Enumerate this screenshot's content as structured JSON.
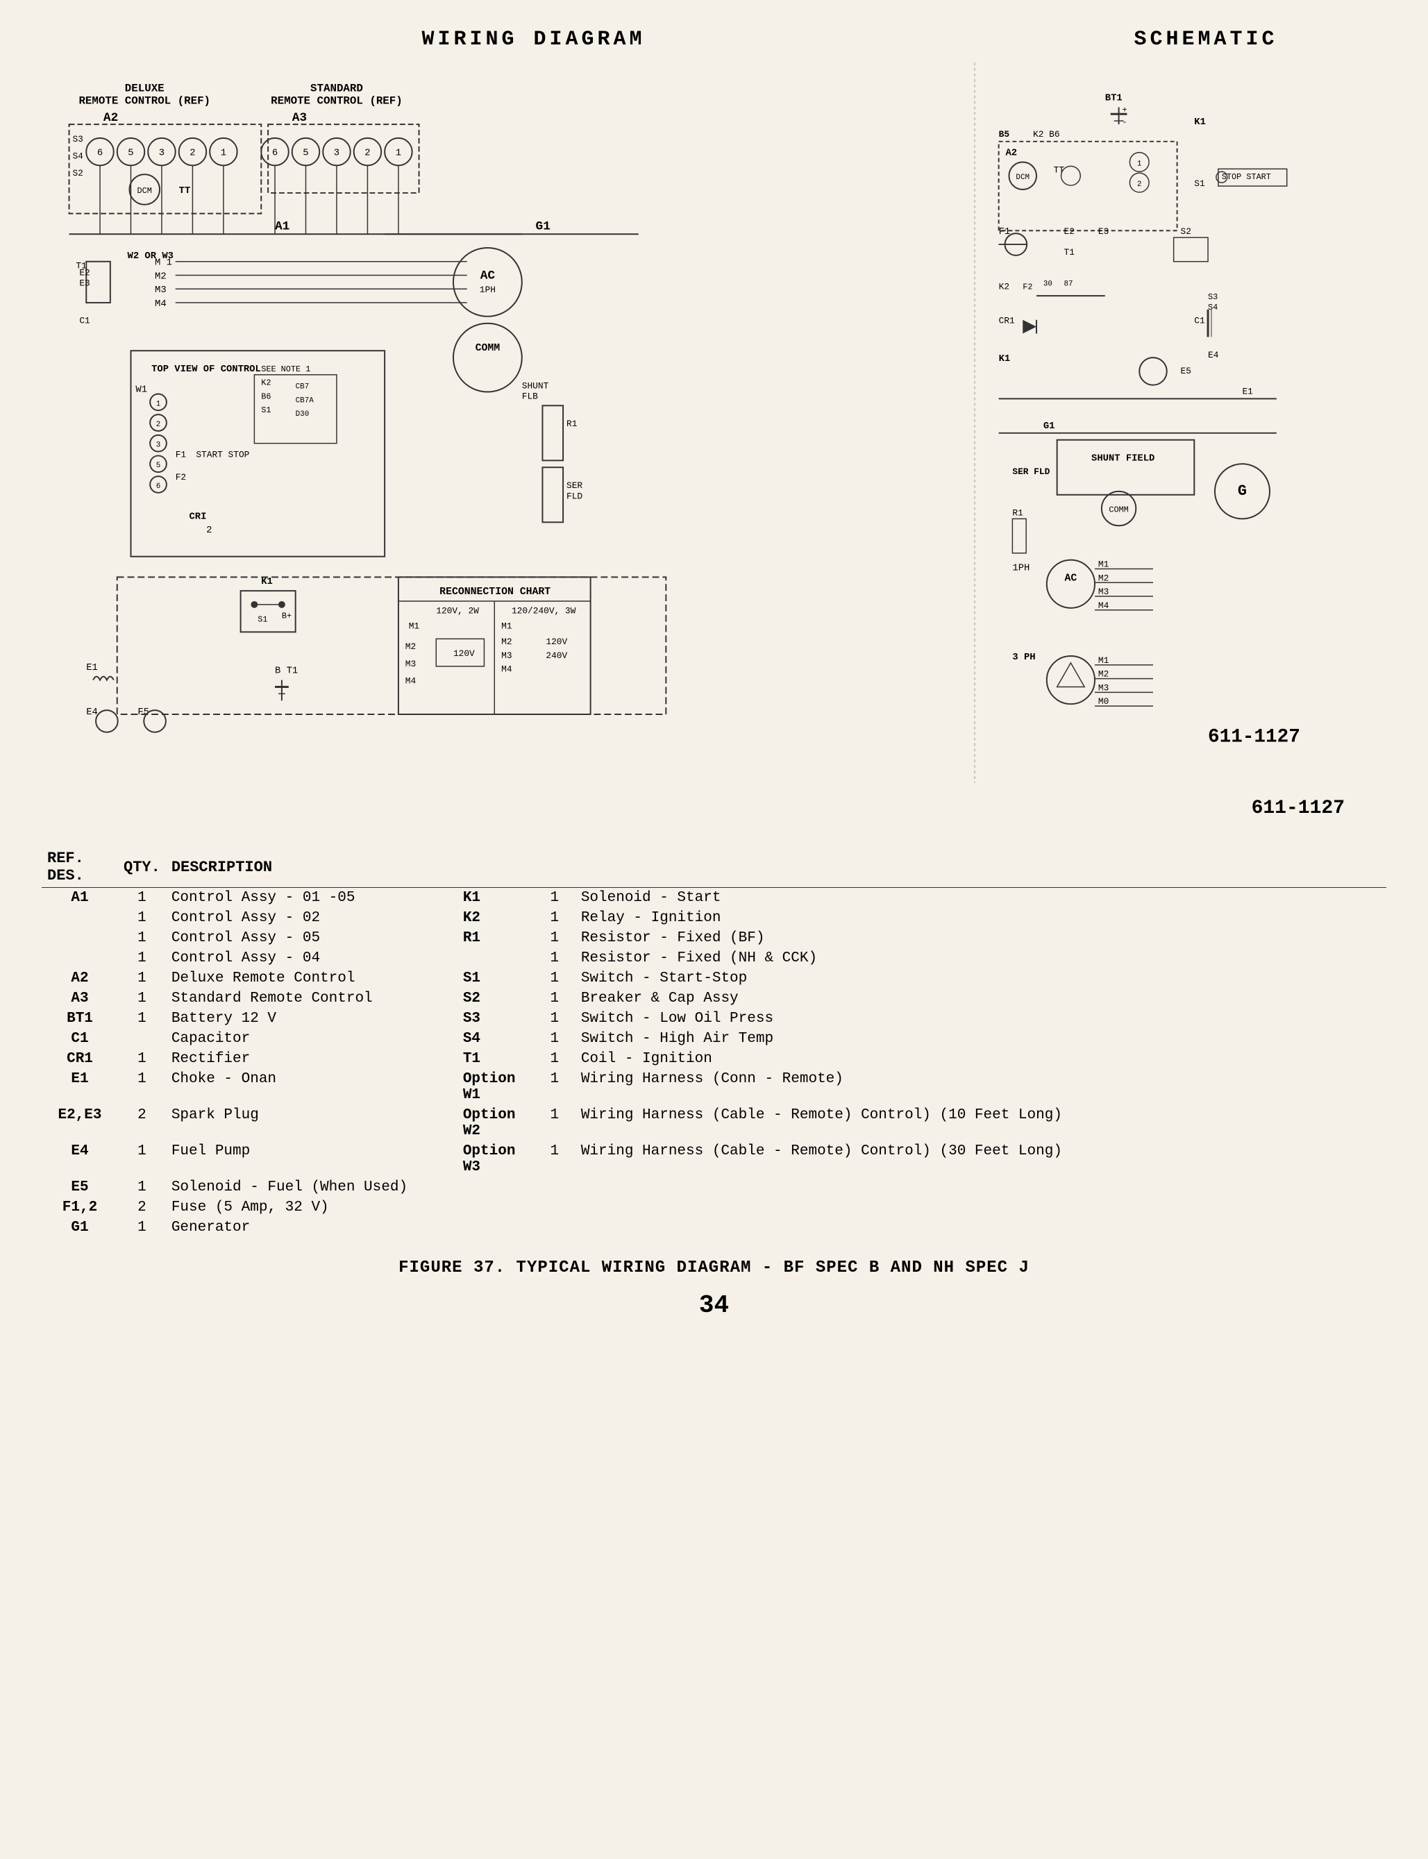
{
  "page": {
    "background": "#f5f0e8",
    "titles": {
      "wiring": "WIRING  DIAGRAM",
      "schematic": "SCHEMATIC"
    },
    "part_number": "611-1127",
    "figure_caption": "FIGURE 37. TYPICAL WIRING DIAGRAM - BF SPEC B AND NH SPEC J",
    "page_number": "34"
  },
  "labels": {
    "a2_label": "DELUXE\nREMOTE CONTROL (REF)",
    "a3_label": "STANDARD\nREMOTE CONTROL (REF)",
    "top_view": "TOP VIEW OF CONTROL",
    "see_note": "SEE NOTE 1",
    "reconnection_chart": "RECONNECTION CHART",
    "standard_remote_control": "Standard Remote Control"
  },
  "table_headers": {
    "ref_des": "REF. DES.",
    "qty": "QTY.",
    "description": "DESCRIPTION"
  },
  "parts": [
    {
      "ref": "A1",
      "qty": "1",
      "desc": "Control Assy - 01 -05"
    },
    {
      "ref": "",
      "qty": "1",
      "desc": "Control Assy - 02"
    },
    {
      "ref": "",
      "qty": "1",
      "desc": "Control Assy - 05"
    },
    {
      "ref": "",
      "qty": "1",
      "desc": "Control Assy - 04"
    },
    {
      "ref": "A2",
      "qty": "1",
      "desc": "Deluxe Remote Control"
    },
    {
      "ref": "A3",
      "qty": "1",
      "desc": "Standard Remote Control"
    },
    {
      "ref": "BT1",
      "qty": "1",
      "desc": "Battery 12 V"
    },
    {
      "ref": "C1",
      "qty": "",
      "desc": "Capacitor"
    },
    {
      "ref": "CR1",
      "qty": "1",
      "desc": "Rectifier"
    },
    {
      "ref": "E1",
      "qty": "1",
      "desc": "Choke - Onan"
    },
    {
      "ref": "E2,E3",
      "qty": "2",
      "desc": "Spark Plug"
    },
    {
      "ref": "E4",
      "qty": "1",
      "desc": "Fuel Pump"
    },
    {
      "ref": "E5",
      "qty": "1",
      "desc": "Solenoid - Fuel (When Used)"
    },
    {
      "ref": "F1,2",
      "qty": "2",
      "desc": "Fuse (5 Amp, 32 V)"
    },
    {
      "ref": "G1",
      "qty": "1",
      "desc": "Generator"
    }
  ],
  "parts_right": [
    {
      "ref": "K1",
      "qty": "1",
      "desc": "Solenoid - Start"
    },
    {
      "ref": "K2",
      "qty": "1",
      "desc": "Relay - Ignition"
    },
    {
      "ref": "R1",
      "qty": "1",
      "desc": "Resistor - Fixed (BF)"
    },
    {
      "ref": "",
      "qty": "1",
      "desc": "Resistor - Fixed (NH & CCK)"
    },
    {
      "ref": "S1",
      "qty": "1",
      "desc": "Switch - Start-Stop"
    },
    {
      "ref": "S2",
      "qty": "1",
      "desc": "Breaker & Cap Assy"
    },
    {
      "ref": "S3",
      "qty": "1",
      "desc": "Switch - Low Oil Press"
    },
    {
      "ref": "S4",
      "qty": "1",
      "desc": "Switch - High Air Temp"
    },
    {
      "ref": "T1",
      "qty": "1",
      "desc": "Coil - Ignition"
    },
    {
      "ref": "Option W1",
      "qty": "1",
      "desc": "Wiring Harness (Conn - Remote)"
    },
    {
      "ref": "Option W2",
      "qty": "1",
      "desc": "Wiring Harness (Cable - Remote) Control) (10 Feet Long)"
    },
    {
      "ref": "Option W3",
      "qty": "1",
      "desc": "Wiring Harness (Cable - Remote) Control) (30 Feet Long)"
    }
  ]
}
